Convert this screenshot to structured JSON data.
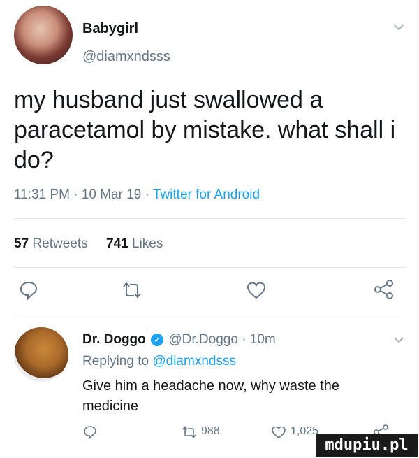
{
  "tweet": {
    "display_name": "Babygirl",
    "handle": "@diamxndsss",
    "text": "my husband just swallowed a paracetamol by mistake. what shall i do?",
    "time": "11:31 PM",
    "date": "10 Mar 19",
    "source": "Twitter for Android",
    "separator": "·",
    "retweets_count": "57",
    "retweets_label": "Retweets",
    "likes_count": "741",
    "likes_label": "Likes"
  },
  "actions": {
    "icons": [
      "reply-icon",
      "retweet-icon",
      "like-icon",
      "share-icon"
    ]
  },
  "reply": {
    "display_name": "Dr. Doggo",
    "handle": "@Dr.Doggo",
    "age": "10m",
    "separator": "·",
    "replying_to_label": "Replying to",
    "replying_to_handle": "@diamxndsss",
    "text": "Give him a headache now, why waste the medicine",
    "retweets": "988",
    "likes": "1,025"
  },
  "watermark": "mdupiu.pl",
  "colors": {
    "link": "#1da1f2",
    "muted": "#657786",
    "text": "#14171a",
    "divider": "#e1e8ed",
    "verified": "#1da1f2"
  }
}
